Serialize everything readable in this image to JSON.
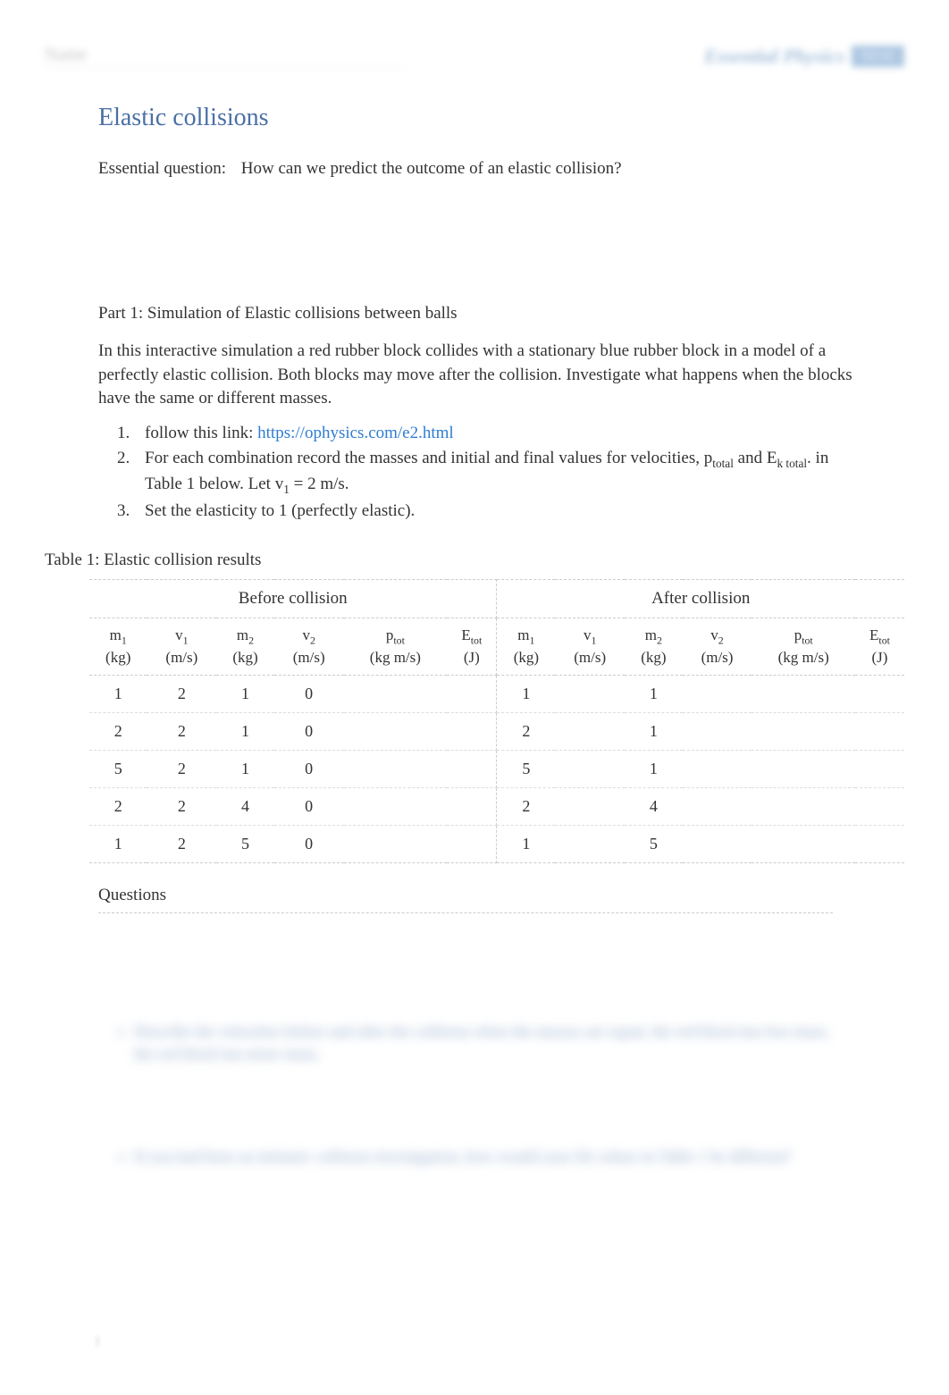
{
  "header": {
    "left_blur": "Name",
    "right_logo": "Essential Physics",
    "right_badge": "3rd ed."
  },
  "title": "Elastic collisions",
  "essential_question": {
    "label": "Essential question:",
    "text": "How can we predict the outcome of an elastic collision?"
  },
  "part1": {
    "header": "Part 1:  Simulation of Elastic collisions between balls",
    "body": "In this interactive simulation a red rubber block collides with a stationary blue rubber block in a model of a perfectly elastic collision. Both blocks may move after the collision. Investigate what happens when the blocks have the same or different masses.",
    "instructions": {
      "item1_pre": "follow this link:  ",
      "item1_link": "https://ophysics.com/e2.html",
      "item2_pre": "For each combination record the masses and initial and final values for velocities, p",
      "item2_sub1": "total",
      "item2_mid": " and E",
      "item2_sub2": "k total",
      "item2_post": ". in Table 1 below.    Let v",
      "item2_sub3": "1",
      "item2_end": " = 2 m/s.",
      "item3": "Set the elasticity to 1 (perfectly elastic)."
    }
  },
  "table": {
    "caption": "Table 1:   Elastic collision results",
    "group_before": "Before collision",
    "group_after": "After collision",
    "col_m1_label": "m",
    "col_m1_sub": "1",
    "col_m1_unit": "(kg)",
    "col_v1_label": "v",
    "col_v1_sub": "1",
    "col_v1_unit": "(m/s)",
    "col_m2_label": "m",
    "col_m2_sub": "2",
    "col_m2_unit": "(kg)",
    "col_v2_label": "v",
    "col_v2_sub": "2",
    "col_v2_unit": "(m/s)",
    "col_ptot_label": "p",
    "col_ptot_sub": "tot",
    "col_ptot_unit": "(kg m/s)",
    "col_etot_label": "E",
    "col_etot_sub": "tot",
    "col_etot_unit": "(J)",
    "rows": [
      {
        "bm1": "1",
        "bv1": "2",
        "bm2": "1",
        "bv2": "0",
        "bp": "",
        "be": "",
        "am1": "1",
        "av1": "",
        "am2": "1",
        "av2": "",
        "ap": "",
        "ae": ""
      },
      {
        "bm1": "2",
        "bv1": "2",
        "bm2": "1",
        "bv2": "0",
        "bp": "",
        "be": "",
        "am1": "2",
        "av1": "",
        "am2": "1",
        "av2": "",
        "ap": "",
        "ae": ""
      },
      {
        "bm1": "5",
        "bv1": "2",
        "bm2": "1",
        "bv2": "0",
        "bp": "",
        "be": "",
        "am1": "5",
        "av1": "",
        "am2": "1",
        "av2": "",
        "ap": "",
        "ae": ""
      },
      {
        "bm1": "2",
        "bv1": "2",
        "bm2": "4",
        "bv2": "0",
        "bp": "",
        "be": "",
        "am1": "2",
        "av1": "",
        "am2": "4",
        "av2": "",
        "ap": "",
        "ae": ""
      },
      {
        "bm1": "1",
        "bv1": "2",
        "bm2": "5",
        "bv2": "0",
        "bp": "",
        "be": "",
        "am1": "1",
        "av1": "",
        "am2": "5",
        "av2": "",
        "ap": "",
        "ae": ""
      }
    ]
  },
  "questions": {
    "label": "Questions",
    "blurred_a": "Describe the velocities before and after the collision when the masses are equal, the red block has less mass, the red block has more mass.",
    "blurred_b": "If you had been an inelastic collision investigation, how would your Ek values in Table 1 be different?"
  },
  "page_number": "1"
}
